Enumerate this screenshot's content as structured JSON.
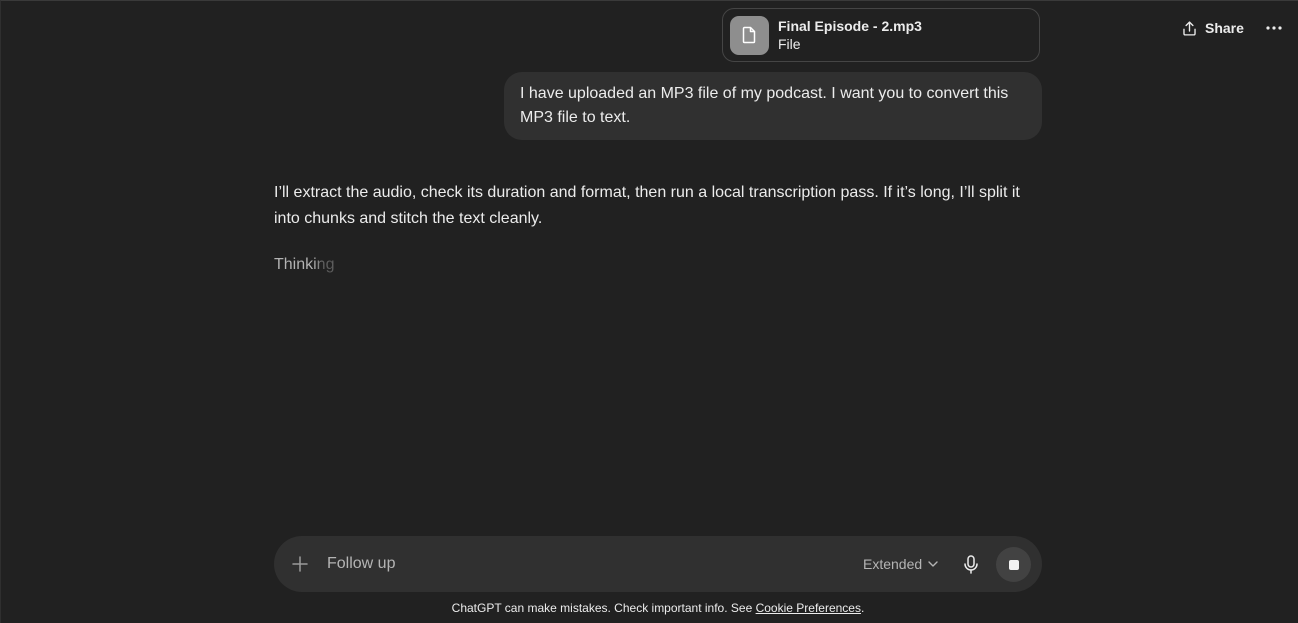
{
  "header": {
    "share_label": "Share",
    "share_icon": "share-upload-icon",
    "more_icon": "more-horizontal-icon"
  },
  "attachment": {
    "file_name": "Final Episode - 2.mp3",
    "file_type": "File",
    "icon": "document-icon"
  },
  "conversation": {
    "user_message": "I have uploaded an MP3 file of my podcast. I want you to convert this MP3 file to text.",
    "assistant_message": "I’ll extract the audio, check its duration and format, then run a local transcription pass. If it’s long, I’ll split it into chunks and stitch the text cleanly.",
    "status": "Thinking"
  },
  "composer": {
    "placeholder": "Follow up",
    "model_label": "Extended",
    "plus_icon": "plus-icon",
    "chevron_icon": "chevron-down-icon",
    "mic_icon": "microphone-icon",
    "stop_icon": "stop-icon"
  },
  "footer": {
    "disclaimer": "ChatGPT can make mistakes. Check important info. See ",
    "link_label": "Cookie Preferences",
    "period": "."
  },
  "colors": {
    "background": "#212121",
    "surface": "#303030",
    "text": "#ececec",
    "muted": "#b4b4b4"
  }
}
